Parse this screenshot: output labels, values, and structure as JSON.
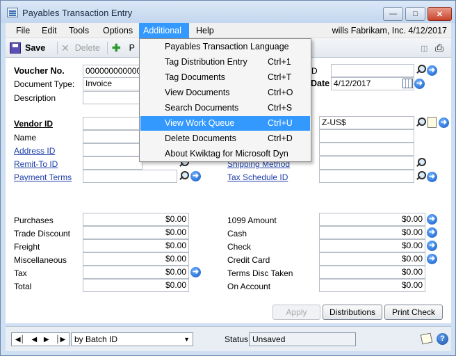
{
  "window": {
    "title": "Payables Transaction Entry",
    "controls": [
      "minimize-icon",
      "maximize-icon",
      "close-icon"
    ]
  },
  "menubar": {
    "items": [
      "File",
      "Edit",
      "Tools",
      "Options",
      "Additional",
      "Help"
    ],
    "active": "Additional",
    "context": "wills  Fabrikam, Inc.  4/12/2017"
  },
  "toolbar": {
    "save": "Save",
    "delete": "Delete",
    "post_partial": "P"
  },
  "additional_menu": [
    {
      "label": "Payables Transaction Language",
      "shortcut": ""
    },
    {
      "label": "Tag Distribution Entry",
      "shortcut": "Ctrl+1"
    },
    {
      "label": "Tag Documents",
      "shortcut": "Ctrl+T"
    },
    {
      "label": "View Documents",
      "shortcut": "Ctrl+O"
    },
    {
      "label": "Search Documents",
      "shortcut": "Ctrl+S"
    },
    {
      "label": "View Work Queue",
      "shortcut": "Ctrl+U",
      "highlighted": true
    },
    {
      "label": "Delete Documents",
      "shortcut": "Ctrl+D"
    },
    {
      "label": "About Kwiktag for Microsoft Dyn",
      "shortcut": ""
    }
  ],
  "header": {
    "voucher_label": "Voucher No.",
    "voucher_value": "00000000000000",
    "doc_type_label": "Document Type:",
    "doc_type_value": "Invoice",
    "description_label": "Description",
    "batch_partial": "D",
    "date_label_partial": "Date",
    "date_value": "4/12/2017"
  },
  "vendor": {
    "vendor_id_label": "Vendor ID",
    "name_label": "Name",
    "address_id_label": "Address ID",
    "remit_to_label": "Remit-To ID",
    "payment_terms_label": "Payment Terms",
    "currency_value": "Z-US$",
    "shipping_label": "Shipping Method",
    "tax_schedule_label": "Tax Schedule ID"
  },
  "amounts_left": [
    {
      "label": "Purchases",
      "value": "$0.00"
    },
    {
      "label": "Trade Discount",
      "value": "$0.00"
    },
    {
      "label": "Freight",
      "value": "$0.00"
    },
    {
      "label": "Miscellaneous",
      "value": "$0.00"
    },
    {
      "label": "Tax",
      "value": "$0.00"
    },
    {
      "label": "Total",
      "value": "$0.00"
    }
  ],
  "amounts_right": [
    {
      "label": "1099 Amount",
      "value": "$0.00"
    },
    {
      "label": "Cash",
      "value": "$0.00"
    },
    {
      "label": "Check",
      "value": "$0.00"
    },
    {
      "label": "Credit Card",
      "value": "$0.00"
    },
    {
      "label": "Terms Disc Taken",
      "value": "$0.00"
    },
    {
      "label": "On Account",
      "value": "$0.00"
    }
  ],
  "buttons": {
    "apply": "Apply",
    "distributions": "Distributions",
    "print_check": "Print Check"
  },
  "statusbar": {
    "sort_value": "by Batch ID",
    "status_label": "Status",
    "status_value": "Unsaved"
  },
  "colors": {
    "menu_highlight": "#3399ff",
    "link": "#1e3fa8",
    "window_frame": "#cfe0f3"
  }
}
